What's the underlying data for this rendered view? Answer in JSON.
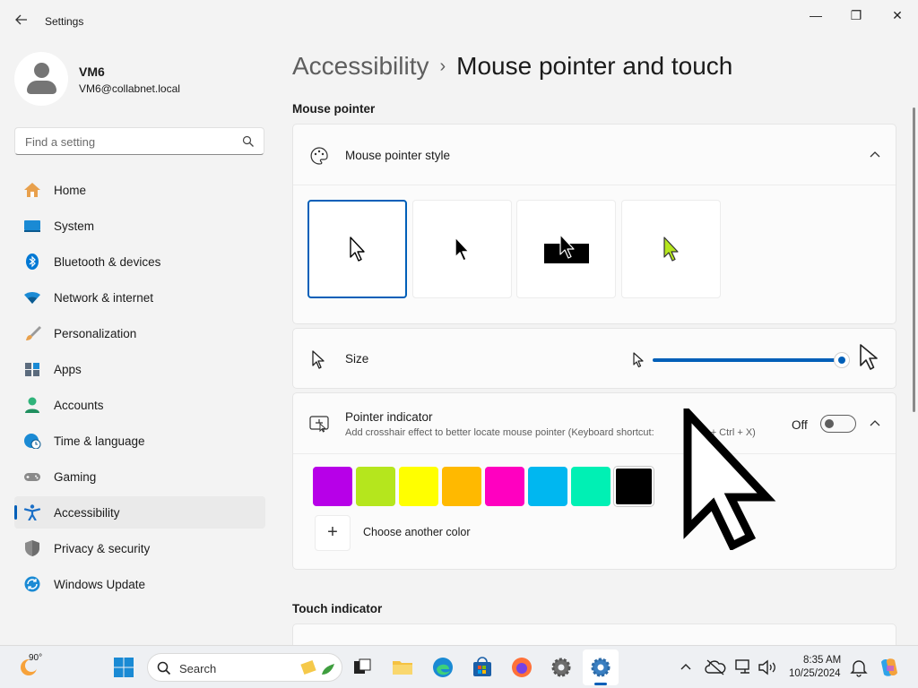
{
  "window": {
    "title": "Settings",
    "controls": {
      "minimize": "—",
      "maximize": "❐",
      "close": "✕"
    }
  },
  "profile": {
    "name": "VM6",
    "email": "VM6@collabnet.local"
  },
  "search": {
    "placeholder": "Find a setting"
  },
  "nav": {
    "items": [
      {
        "label": "Home",
        "icon": "home-icon"
      },
      {
        "label": "System",
        "icon": "system-icon"
      },
      {
        "label": "Bluetooth & devices",
        "icon": "bluetooth-icon"
      },
      {
        "label": "Network & internet",
        "icon": "wifi-icon"
      },
      {
        "label": "Personalization",
        "icon": "brush-icon"
      },
      {
        "label": "Apps",
        "icon": "apps-icon"
      },
      {
        "label": "Accounts",
        "icon": "accounts-icon"
      },
      {
        "label": "Time & language",
        "icon": "clock-globe-icon"
      },
      {
        "label": "Gaming",
        "icon": "gamepad-icon"
      },
      {
        "label": "Accessibility",
        "icon": "accessibility-icon",
        "active": true
      },
      {
        "label": "Privacy & security",
        "icon": "shield-icon"
      },
      {
        "label": "Windows Update",
        "icon": "update-icon"
      }
    ]
  },
  "breadcrumb": {
    "parent": "Accessibility",
    "separator": "›",
    "current": "Mouse pointer and touch"
  },
  "sections": {
    "mouse_pointer": "Mouse pointer",
    "touch_indicator": "Touch indicator"
  },
  "pointer_style": {
    "label": "Mouse pointer style",
    "options": [
      "white",
      "black",
      "inverted",
      "custom"
    ],
    "selected": "white",
    "custom_color": "#b5e61d"
  },
  "size": {
    "label": "Size",
    "value_fraction": 1.0
  },
  "pointer_indicator": {
    "label": "Pointer indicator",
    "description": "Add crosshair effect to better locate mouse pointer (Keyboard shortcut: ",
    "description_tail": "+ Ctrl + X)",
    "toggle_label": "Off",
    "toggle_on": false
  },
  "colors": {
    "swatches": [
      "#b700e8",
      "#b5e61d",
      "#ffff00",
      "#ffb900",
      "#ff00c0",
      "#00b7f0",
      "#00f0b4",
      "#000000"
    ],
    "selected": "#000000",
    "choose_label": "Choose another color",
    "accent": "#005fb8"
  },
  "taskbar": {
    "weather": "90°",
    "search_label": "Search",
    "time": "8:35 AM",
    "date": "10/25/2024"
  }
}
